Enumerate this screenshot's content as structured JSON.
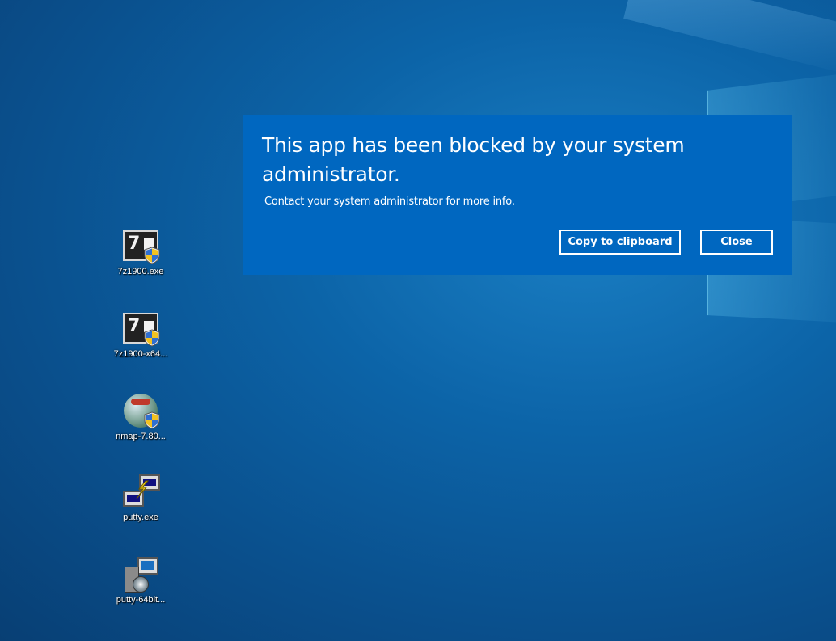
{
  "colors": {
    "dialog_background": "#0067c0",
    "dialog_text": "#ffffff",
    "desktop_background": "#0c64a8"
  },
  "dialog": {
    "title": "This app has been blocked by your system administrator.",
    "message": "Contact your system administrator for more info.",
    "copy_button_label": "Copy to clipboard",
    "close_button_label": "Close"
  },
  "desktop": {
    "icons": [
      {
        "label": "7z1900.exe",
        "icon": "7zip-installer-icon"
      },
      {
        "label": "7z1900-x64...",
        "icon": "7zip-installer-icon"
      },
      {
        "label": "nmap-7.80...",
        "icon": "nmap-installer-icon"
      },
      {
        "label": "putty.exe",
        "icon": "putty-icon"
      },
      {
        "label": "putty-64bit...",
        "icon": "putty-installer-icon"
      }
    ]
  }
}
